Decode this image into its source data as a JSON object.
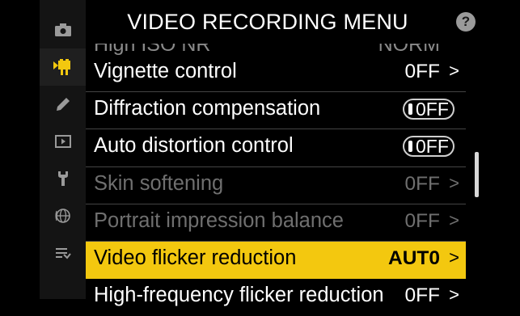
{
  "header": {
    "title": "VIDEO RECORDING MENU",
    "help": "?"
  },
  "sidebar": {
    "items": [
      {
        "icon": "camera-icon"
      },
      {
        "icon": "video-camera-icon"
      },
      {
        "icon": "pencil-icon"
      },
      {
        "icon": "playback-icon"
      },
      {
        "icon": "wrench-icon"
      },
      {
        "icon": "network-icon"
      },
      {
        "icon": "my-menu-icon"
      }
    ]
  },
  "cutoff_item": {
    "label": "High ISO NR",
    "value": "NORM"
  },
  "menu": {
    "items": [
      {
        "label": "Vignette control",
        "value": "0FF",
        "chevron": ">"
      },
      {
        "label": "Diffraction compensation",
        "value": "0FF"
      },
      {
        "label": "Auto distortion control",
        "value": "0FF"
      },
      {
        "label": "Skin softening",
        "value": "0FF",
        "chevron": ">"
      },
      {
        "label": "Portrait impression balance",
        "value": "0FF",
        "chevron": ">"
      },
      {
        "label": "Video flicker reduction",
        "value": "AUT0",
        "chevron": ">"
      },
      {
        "label": "High-frequency flicker reduction",
        "value": "0FF",
        "chevron": ">"
      }
    ]
  },
  "colors": {
    "selected": "#f3c80f",
    "disabled_text": "#6f6f6f"
  }
}
